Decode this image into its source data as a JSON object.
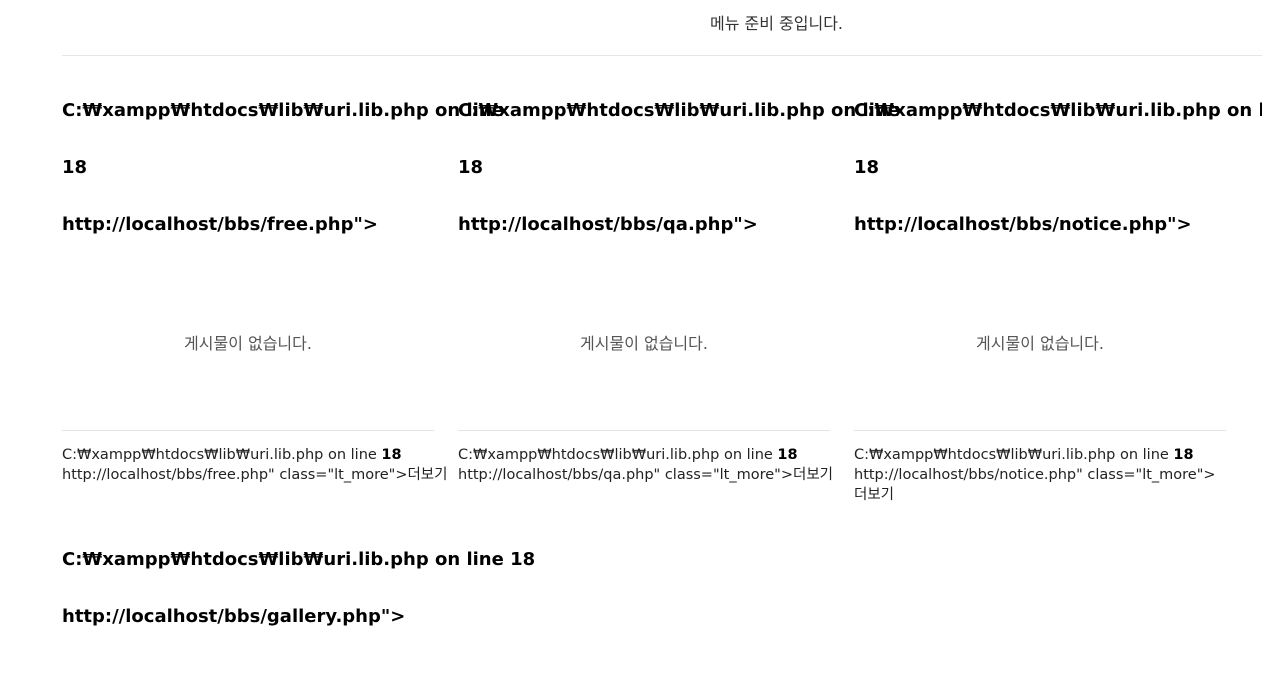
{
  "header": {
    "menu_notice": "메뉴 준비 중입니다."
  },
  "boards": [
    {
      "title_error": "C:₩xampp₩htdocs₩lib₩uri.lib.php on line",
      "title_line": "18",
      "title_url": "http://localhost/bbs/free.php\">",
      "empty_message": "게시물이 없습니다.",
      "more_error": "C:₩xampp₩htdocs₩lib₩uri.lib.php on line ",
      "more_line": "18",
      "more_text": "http://localhost/bbs/free.php\" class=\"lt_more\">더보기"
    },
    {
      "title_error": "C:₩xampp₩htdocs₩lib₩uri.lib.php on line",
      "title_line": "18",
      "title_url": "http://localhost/bbs/qa.php\">",
      "empty_message": "게시물이 없습니다.",
      "more_error": "C:₩xampp₩htdocs₩lib₩uri.lib.php on line ",
      "more_line": "18",
      "more_text": "http://localhost/bbs/qa.php\" class=\"lt_more\">더보기"
    },
    {
      "title_error": "C:₩xampp₩htdocs₩lib₩uri.lib.php on line",
      "title_line": "18",
      "title_url": "http://localhost/bbs/notice.php\">",
      "empty_message": "게시물이 없습니다.",
      "more_error": "C:₩xampp₩htdocs₩lib₩uri.lib.php on line ",
      "more_line": "18",
      "more_text": "http://localhost/bbs/notice.php\" class=\"lt_more\">더보기"
    }
  ],
  "gallery": {
    "title_error": "C:₩xampp₩htdocs₩lib₩uri.lib.php on line 18",
    "title_url": "http://localhost/bbs/gallery.php\">"
  }
}
